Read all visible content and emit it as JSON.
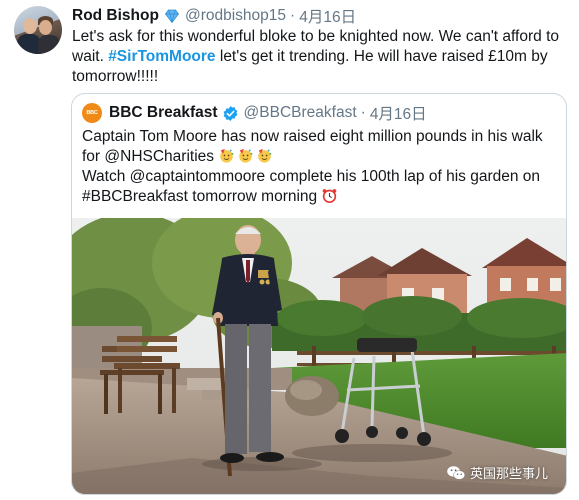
{
  "tweet": {
    "author_name": "Rod Bishop",
    "author_handle": "@rodbishop15",
    "separator": "·",
    "date": "4月16日",
    "text_part1": "Let's ask for this wonderful bloke to be knighted now. We can't afford to wait. ",
    "hashtag": "#SirTomMoore",
    "text_part2": " let's get it trending. He will have raised £10m by tomorrow!!!!!",
    "badge_icon": "diamond-icon"
  },
  "quoted_tweet": {
    "avatar_label": "BBC",
    "author_name": "BBC Breakfast",
    "author_handle": "@BBCBreakfast",
    "separator": "·",
    "date": "4月16日",
    "line1": "Captain Tom Moore has now raised eight million pounds in his walk for @NHSCharities",
    "line2": "Watch @captaintommoore complete his 100th lap of his garden on #BBCBreakfast tomorrow morning",
    "verified_icon": "verified-badge-icon",
    "emoji_line1": [
      "party-face-icon",
      "party-face-icon",
      "party-face-icon"
    ],
    "emoji_line2": "alarm-clock-icon"
  },
  "watermark": {
    "text": "英国那些事儿",
    "icon": "wechat-icon"
  },
  "colors": {
    "link": "#1b95e0",
    "secondary_text": "#657786",
    "border": "#ccd6dd",
    "bbc_orange": "#f08a17",
    "verified_blue": "#1da1f2"
  }
}
